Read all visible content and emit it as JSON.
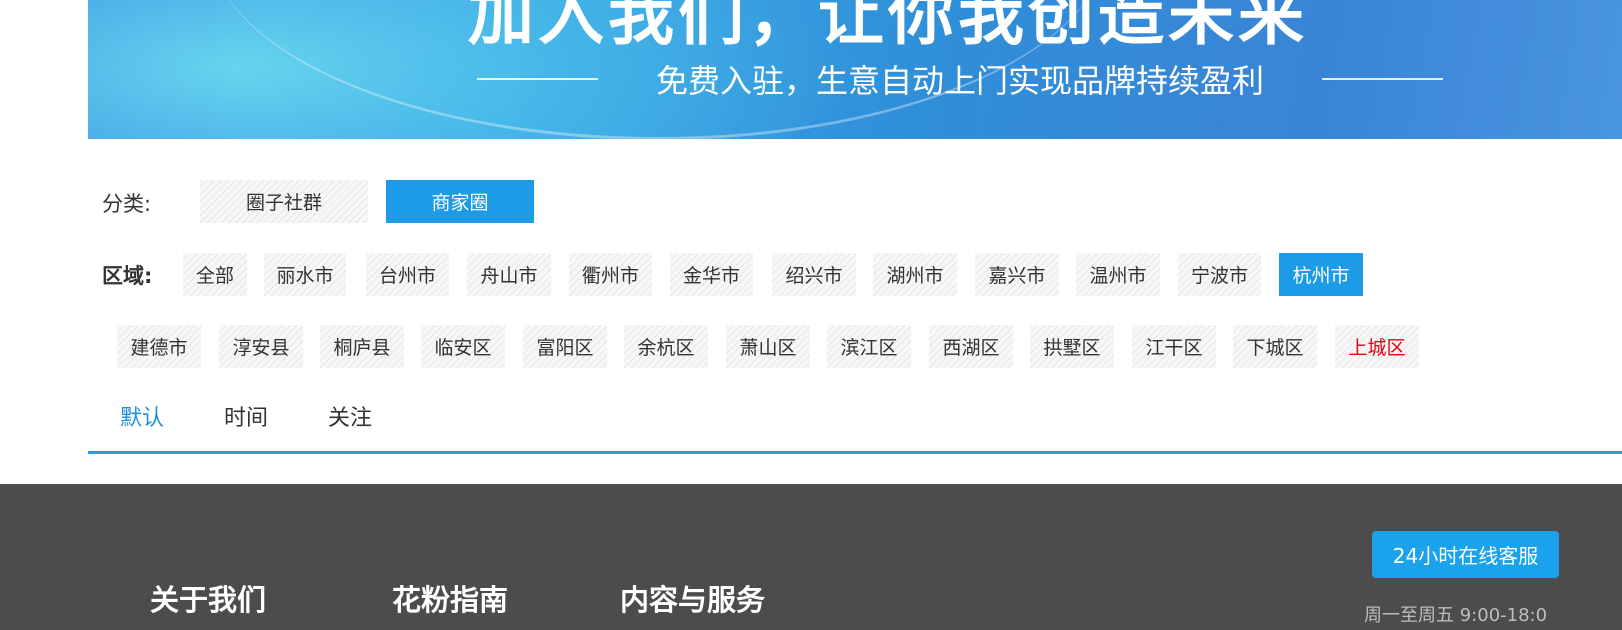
{
  "banner": {
    "title": "加入我们，让你我创造未来",
    "subtitle": "免费入驻，生意自动上门实现品牌持续盈利"
  },
  "category": {
    "label": "分类:",
    "items": [
      {
        "label": "圈子社群",
        "active": false
      },
      {
        "label": "商家圈",
        "active": true
      }
    ]
  },
  "region": {
    "label": "区域:",
    "cities": [
      "全部",
      "丽水市",
      "台州市",
      "舟山市",
      "衢州市",
      "金华市",
      "绍兴市",
      "湖州市",
      "嘉兴市",
      "温州市",
      "宁波市",
      "杭州市"
    ],
    "active_city": "杭州市",
    "districts": [
      "建德市",
      "淳安县",
      "桐庐县",
      "临安区",
      "富阳区",
      "余杭区",
      "萧山区",
      "滨江区",
      "西湖区",
      "拱墅区",
      "江干区",
      "下城区",
      "上城区"
    ],
    "highlighted_district": "上城区"
  },
  "sort": {
    "tabs": [
      "默认",
      "时间",
      "关注"
    ],
    "active": "默认"
  },
  "footer": {
    "headings": [
      "关于我们",
      "花粉指南",
      "内容与服务"
    ],
    "service_button": "24小时在线客服",
    "phone_fragment": "周一至周五 9:00-18:0"
  },
  "colors": {
    "accent_blue": "#1e9be6",
    "sort_active": "#1e8fe0",
    "highlight_red": "#e60012",
    "footer_bg": "#4c4c4c",
    "service_button_bg": "#1aa3ec"
  }
}
